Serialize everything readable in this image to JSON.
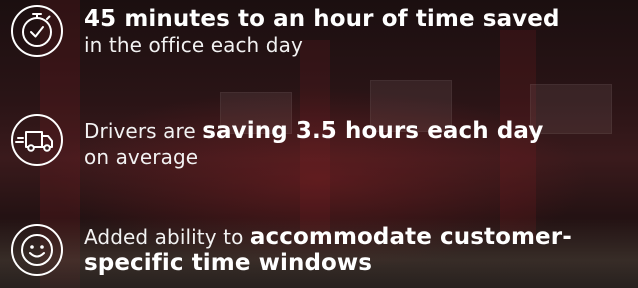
{
  "items": [
    {
      "icon": "clock-check-icon",
      "bold_text": "45 minutes to an hour of time saved",
      "normal_text": "in the office each day"
    },
    {
      "icon": "delivery-truck-icon",
      "lead_text": "Drivers are",
      "bold_text": "saving 3.5 hours each day",
      "normal_text": "on average"
    },
    {
      "icon": "smiley-face-icon",
      "lead_text": "Added ability to",
      "bold_text": "accommodate customer-specific time windows"
    }
  ]
}
